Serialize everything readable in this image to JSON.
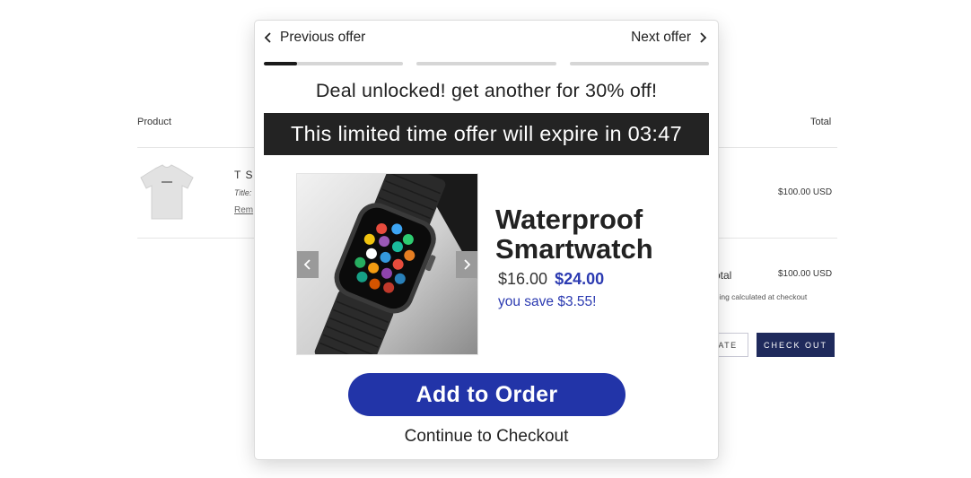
{
  "cart": {
    "headers": {
      "product": "Product",
      "total": "Total"
    },
    "item": {
      "name": "T SH",
      "variant": "Title:",
      "remove": "Rem",
      "price": "$100.00 USD"
    },
    "subtotal_label": "otal",
    "subtotal_value": "$100.00 USD",
    "shipping_note": "pping calculated at checkout",
    "update_label": "DATE",
    "checkout_label": "CHECK OUT"
  },
  "modal": {
    "prev_label": "Previous offer",
    "next_label": "Next offer",
    "progress": [
      0.24,
      0,
      0
    ],
    "headline": "Deal unlocked! get another for 30% off!",
    "timer_text": "This limited time offer will expire in 03:47",
    "product": {
      "title": "Waterproof Smartwatch",
      "original_price": "$16.00",
      "sale_price": "$24.00",
      "savings": "you save $3.55!",
      "image": "smartwatch-photo"
    },
    "add_button": "Add to Order",
    "continue_link": "Continue to Checkout"
  },
  "colors": {
    "accent": "#2234a8",
    "timer_bg": "#232323",
    "checkout_btn": "#1f2a5c"
  },
  "icons": [
    "chevron-left-icon",
    "chevron-right-icon"
  ]
}
